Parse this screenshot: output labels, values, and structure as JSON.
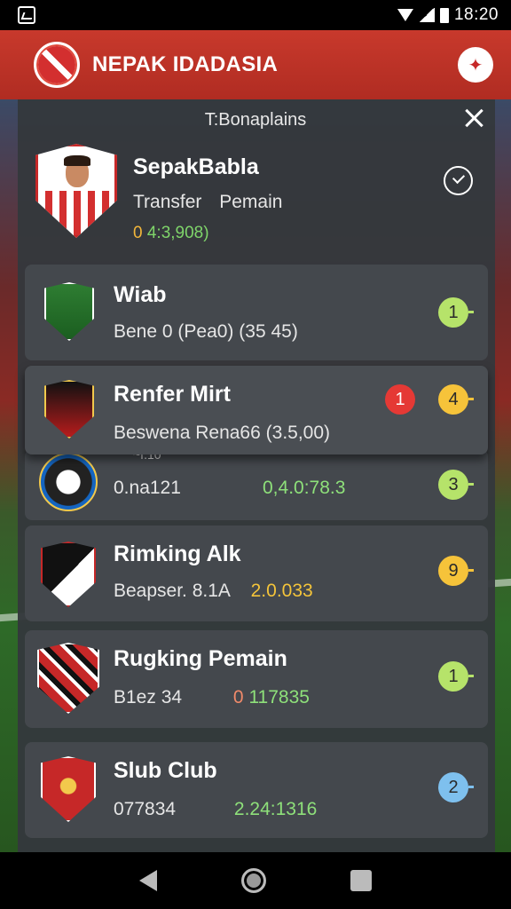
{
  "status_bar": {
    "time": "18:20"
  },
  "app_bar": {
    "title": "NEPAK IDADASIA",
    "action_icon": "compass-star-icon"
  },
  "panel": {
    "title": "T:Bonaplains",
    "close_icon": "close-icon"
  },
  "player": {
    "name": "SepakBabla",
    "meta": "Transfer Pemain",
    "value_prefix": "0",
    "value_rest": "4:3,908)"
  },
  "cards": [
    {
      "title": "Wiab",
      "sub": "Bene 0 (Pea0)",
      "sub_value": "(35 45)",
      "badge": "1",
      "badge_color": "#b6e36a"
    },
    {
      "title": "Renfer Mirt",
      "sub": "Beswena Rena66",
      "sub_value": "(3.5,00)",
      "badge": "4",
      "badge_color": "#f6c33a",
      "alert_badge": "1"
    },
    {
      "title": "0.na121",
      "sub": "0,4.0:78.3",
      "badge": "3",
      "badge_color": "#b6e36a",
      "partial_title": "~f.10"
    },
    {
      "title": "Rimking Alk",
      "sub": "Beapser. 8.1A",
      "sub_value": "2.0.033",
      "badge": "9",
      "badge_color": "#f6c33a"
    },
    {
      "title": "Rugking Pemain",
      "sub": "B1ez 34",
      "sub_value_a": "0",
      "sub_value_b": "117835",
      "badge": "1",
      "badge_color": "#b6e36a"
    },
    {
      "title": "Slub Club",
      "sub": "077834",
      "sub_value": "2.24:1316",
      "badge": "2",
      "badge_color": "#7ec0ee"
    }
  ]
}
